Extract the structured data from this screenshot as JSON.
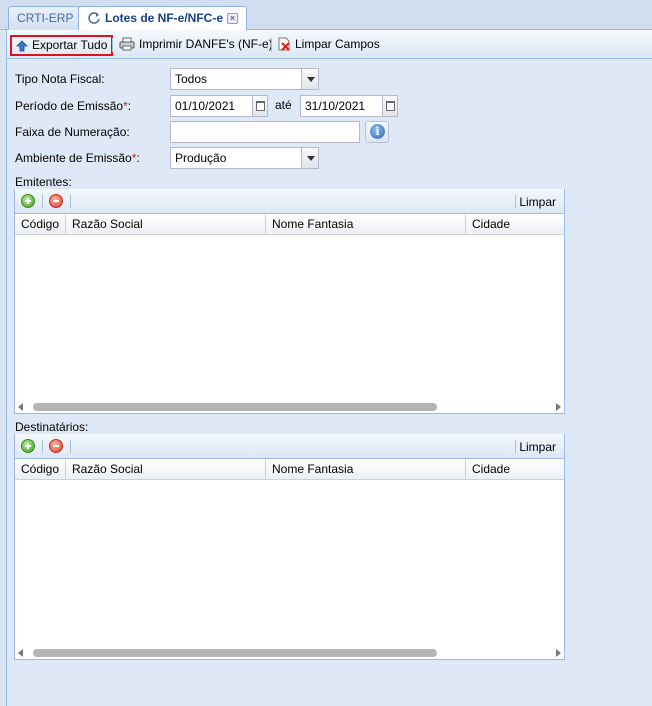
{
  "tabs": [
    {
      "label": "CRTI-ERP",
      "active": false
    },
    {
      "label": "Lotes de NF-e/NFC-e",
      "active": true,
      "closable": true
    }
  ],
  "toolbar": {
    "export_label": "Exportar Tudo",
    "print_label": "Imprimir DANFE's (NF-e)",
    "clear_label": "Limpar Campos"
  },
  "form": {
    "tipo_label": "Tipo Nota Fiscal:",
    "tipo_value": "Todos",
    "periodo_label": "Período de Emissão",
    "periodo_start": "01/10/2021",
    "periodo_sep": "até",
    "periodo_end": "31/10/2021",
    "faixa_label": "Faixa de Numeração:",
    "faixa_value": "",
    "ambiente_label": "Ambiente de Emissão",
    "ambiente_value": "Produção",
    "required_mark": "*",
    "colon": ":"
  },
  "emitentes": {
    "title": "Emitentes:",
    "limpar": "Limpar",
    "columns": [
      "Código",
      "Razão Social",
      "Nome Fantasia",
      "Cidade"
    ],
    "rows": []
  },
  "destinatarios": {
    "title": "Destinatários:",
    "limpar": "Limpar",
    "columns": [
      "Código",
      "Razão Social",
      "Nome Fantasia",
      "Cidade"
    ],
    "rows": []
  },
  "colors": {
    "accent": "#15428b",
    "highlight_border": "#e0101c",
    "panel_bg": "#dfe8f6"
  }
}
